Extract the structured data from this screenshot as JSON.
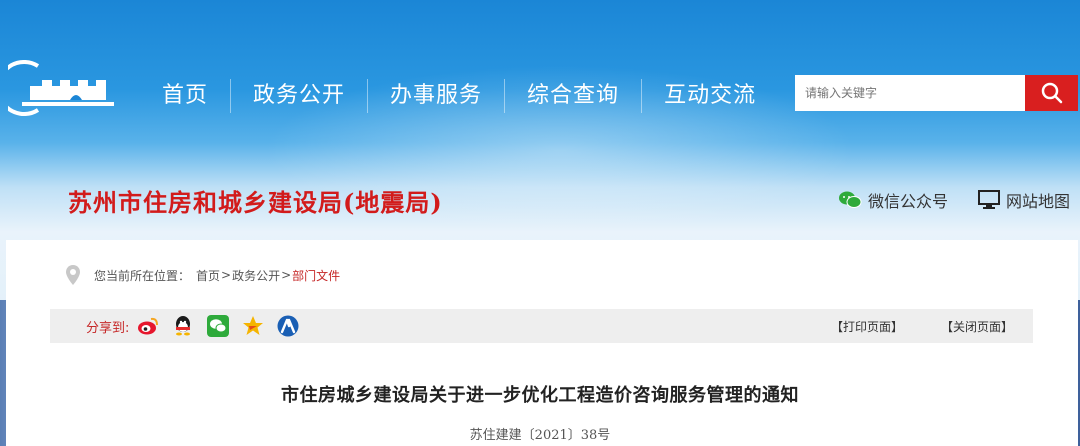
{
  "header": {
    "nav": [
      "首页",
      "政务公开",
      "办事服务",
      "综合查询",
      "互动交流"
    ],
    "search": {
      "placeholder": "请输入关键字"
    }
  },
  "site": {
    "title": "苏州市住房和城乡建设局(地震局)",
    "links": {
      "wechat": "微信公众号",
      "sitemap": "网站地图"
    }
  },
  "breadcrumb": {
    "prefix": "您当前所在位置：",
    "items": [
      "首页",
      "政务公开",
      "部门文件"
    ],
    "separator": ">"
  },
  "share": {
    "label": "分享到:",
    "icons": [
      "weibo-icon",
      "qq-icon",
      "wechat-icon",
      "qzone-icon",
      "renren-icon"
    ],
    "print": "【打印页面】",
    "close": "【关闭页面】"
  },
  "article": {
    "title": "市住房城乡建设局关于进一步优化工程造价咨询服务管理的通知",
    "doc_number": "苏住建建〔2021〕38号"
  },
  "colors": {
    "brand_red": "#d21b1b",
    "nav_blue": "#1b86d6",
    "search_button": "#d91f1f"
  }
}
